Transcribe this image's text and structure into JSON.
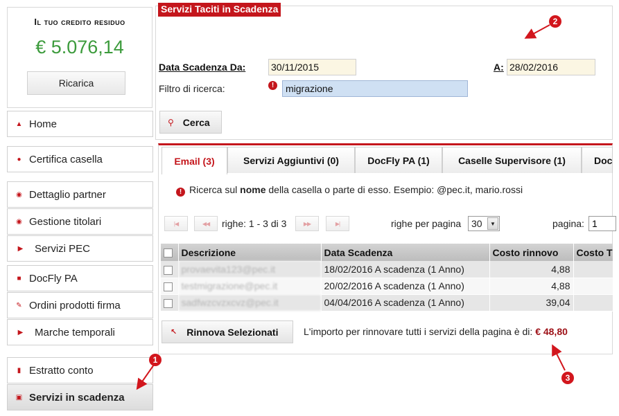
{
  "credit": {
    "title": "Il tuo credito residuo",
    "amount": "€ 5.076,14",
    "recharge_label": "Ricarica"
  },
  "sidebar": {
    "items": [
      {
        "label": "Home",
        "icon": "home-icon"
      },
      {
        "label": "Certifica casella",
        "icon": "certify-icon"
      },
      {
        "label": "Dettaglio partner",
        "icon": "user-icon"
      },
      {
        "label": "Gestione titolari",
        "icon": "user-icon"
      },
      {
        "label": "Servizi PEC",
        "icon": "chevron-right-icon"
      },
      {
        "label": "DocFly PA",
        "icon": "folder-icon"
      },
      {
        "label": "Ordini prodotti firma",
        "icon": "pen-icon"
      },
      {
        "label": "Marche temporali",
        "icon": "chevron-right-icon"
      },
      {
        "label": "Estratto conto",
        "icon": "statement-icon"
      },
      {
        "label": "Servizi in scadenza",
        "icon": "calendar-icon"
      }
    ]
  },
  "filter": {
    "panel_title": "Servizi Taciti in Scadenza",
    "date_from_label": "Data Scadenza Da:",
    "date_from_value": "30/11/2015",
    "date_to_label": "A:",
    "date_to_value": "28/02/2016",
    "search_label": "Filtro di ricerca:",
    "search_value": "migrazione",
    "search_button": "Cerca"
  },
  "tabs": [
    {
      "label": "Email (3)",
      "active": true
    },
    {
      "label": "Servizi Aggiuntivi (0)",
      "active": false
    },
    {
      "label": "DocFly PA (1)",
      "active": false
    },
    {
      "label": "Caselle Supervisore (1)",
      "active": false
    },
    {
      "label": "Doc",
      "active": false
    }
  ],
  "hint": {
    "prefix": "Ricerca sul ",
    "bold": "nome",
    "suffix": " della casella o parte di esso. Esempio: @pec.it, mario.rossi"
  },
  "pager": {
    "rows_info": "righe: 1 - 3 di 3",
    "rows_per_page_label": "righe per pagina",
    "rows_per_page_value": "30",
    "page_label": "pagina:",
    "page_value": "1"
  },
  "table": {
    "columns": [
      "Descrizione",
      "Data Scadenza",
      "Costo rinnovo",
      "Costo T"
    ],
    "rows": [
      {
        "descrizione": "provaevita123@pec.it",
        "data": "18/02/2016 A scadenza (1 Anno)",
        "costo": "4,88"
      },
      {
        "descrizione": "testmigrazione@pec.it",
        "data": "20/02/2016 A scadenza (1 Anno)",
        "costo": "4,88"
      },
      {
        "descrizione": "sadfwzcvzxcvz@pec.it",
        "data": "04/04/2016 A scadenza (1 Anno)",
        "costo": "39,04"
      }
    ]
  },
  "footer": {
    "renew_button": "Rinnova Selezionati",
    "import_text": "L'importo per rinnovare tutti i servizi della pagina è di:",
    "import_value": "€ 48,80"
  },
  "annotations": [
    "1",
    "2",
    "3"
  ],
  "colors": {
    "accent": "#c4161c",
    "credit": "#3c9b3c",
    "import_value": "#9d1016"
  }
}
